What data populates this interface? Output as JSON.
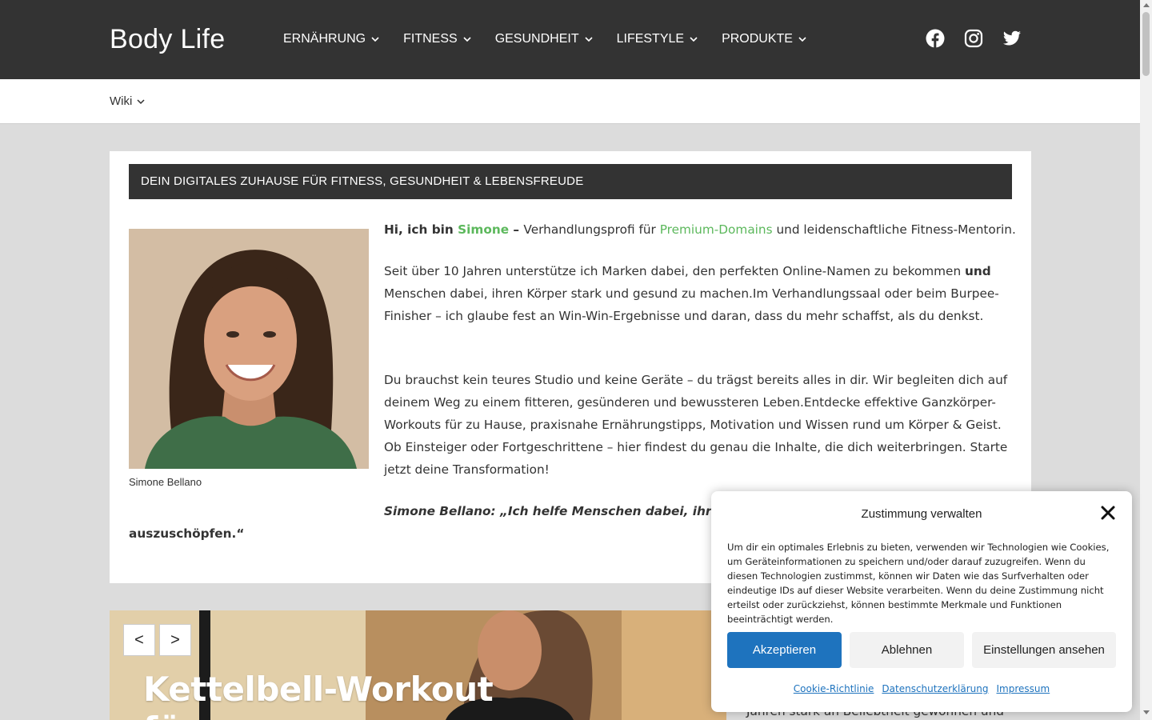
{
  "header": {
    "logo": "Body Life",
    "nav": [
      {
        "label": "ERNÄHRUNG"
      },
      {
        "label": "FITNESS"
      },
      {
        "label": "GESUNDHEIT"
      },
      {
        "label": "LIFESTYLE"
      },
      {
        "label": "PRODUKTE"
      }
    ],
    "social": [
      "facebook-icon",
      "instagram-icon",
      "twitter-icon"
    ]
  },
  "subnav": {
    "wiki": "Wiki"
  },
  "main": {
    "banner": "DEIN DIGITALES ZUHAUSE FÜR FITNESS, GESUNDHEIT & LEBENSFREUDE",
    "photo_caption": "Simone Bellano",
    "p1": {
      "intro": "Hi, ich bin ",
      "name": "Simone",
      "dash": " – ",
      "mid": "Verhandlungsprofi für ",
      "link": "Premium-Domains",
      "end": " und leidenschaftliche Fitness-Mentorin."
    },
    "p2": {
      "a": "Seit über 10 Jahren unterstütze ich Marken dabei, den perfekten Online-Namen zu bekommen ",
      "bold": "und",
      "b": " Menschen dabei, ihren Körper stark und gesund zu machen.Im Verhandlungssaal oder beim Burpee-Finisher – ich glaube fest an Win-Win-Ergebnisse und daran, dass du mehr schaffst, als du denkst."
    },
    "p3": "Du brauchst kein teures Studio und keine Geräte – du trägst bereits alles in dir. Wir begleiten dich auf deinem Weg zu einem fitteren, gesünderen und bewussteren Leben.Entdecke effektive Ganzkörper-Workouts für zu Hause, praxisnahe Ernährungstipps, Motivation und Wissen rund um Körper & Geist. Ob Einsteiger oder Fortgeschrittene – hier findest du genau die Inhalte, die dich weiterbringen. Starte jetzt deine Transformation!",
    "quote_line1": "Simone Bellano: „Ich helfe Menschen dabei, ihr digital",
    "quote_line2": "auszuschöpfen.“"
  },
  "slider": {
    "prev": "<",
    "next": ">",
    "title_line1": "Kettelbell-Workout",
    "title_line2": "für zu"
  },
  "side_text": "Jahren stark an Beliebtheit gewonnen und",
  "cookie": {
    "title": "Zustimmung verwalten",
    "text": "Um dir ein optimales Erlebnis zu bieten, verwenden wir Technologien wie Cookies, um Geräteinformationen zu speichern und/oder darauf zuzugreifen. Wenn du diesen Technologien zustimmst, können wir Daten wie das Surfverhalten oder eindeutige IDs auf dieser Website verarbeiten. Wenn du deine Zustimmung nicht erteilst oder zurückziehst, können bestimmte Merkmale und Funktionen beeinträchtigt werden.",
    "accept": "Akzeptieren",
    "deny": "Ablehnen",
    "prefs": "Einstellungen ansehen",
    "links": [
      "Cookie-Richtlinie",
      "Datenschutzerklärung",
      "Impressum"
    ]
  },
  "colors": {
    "header_bg": "#333333",
    "accent_green": "#5cb85c",
    "button_blue": "#1e73be"
  }
}
